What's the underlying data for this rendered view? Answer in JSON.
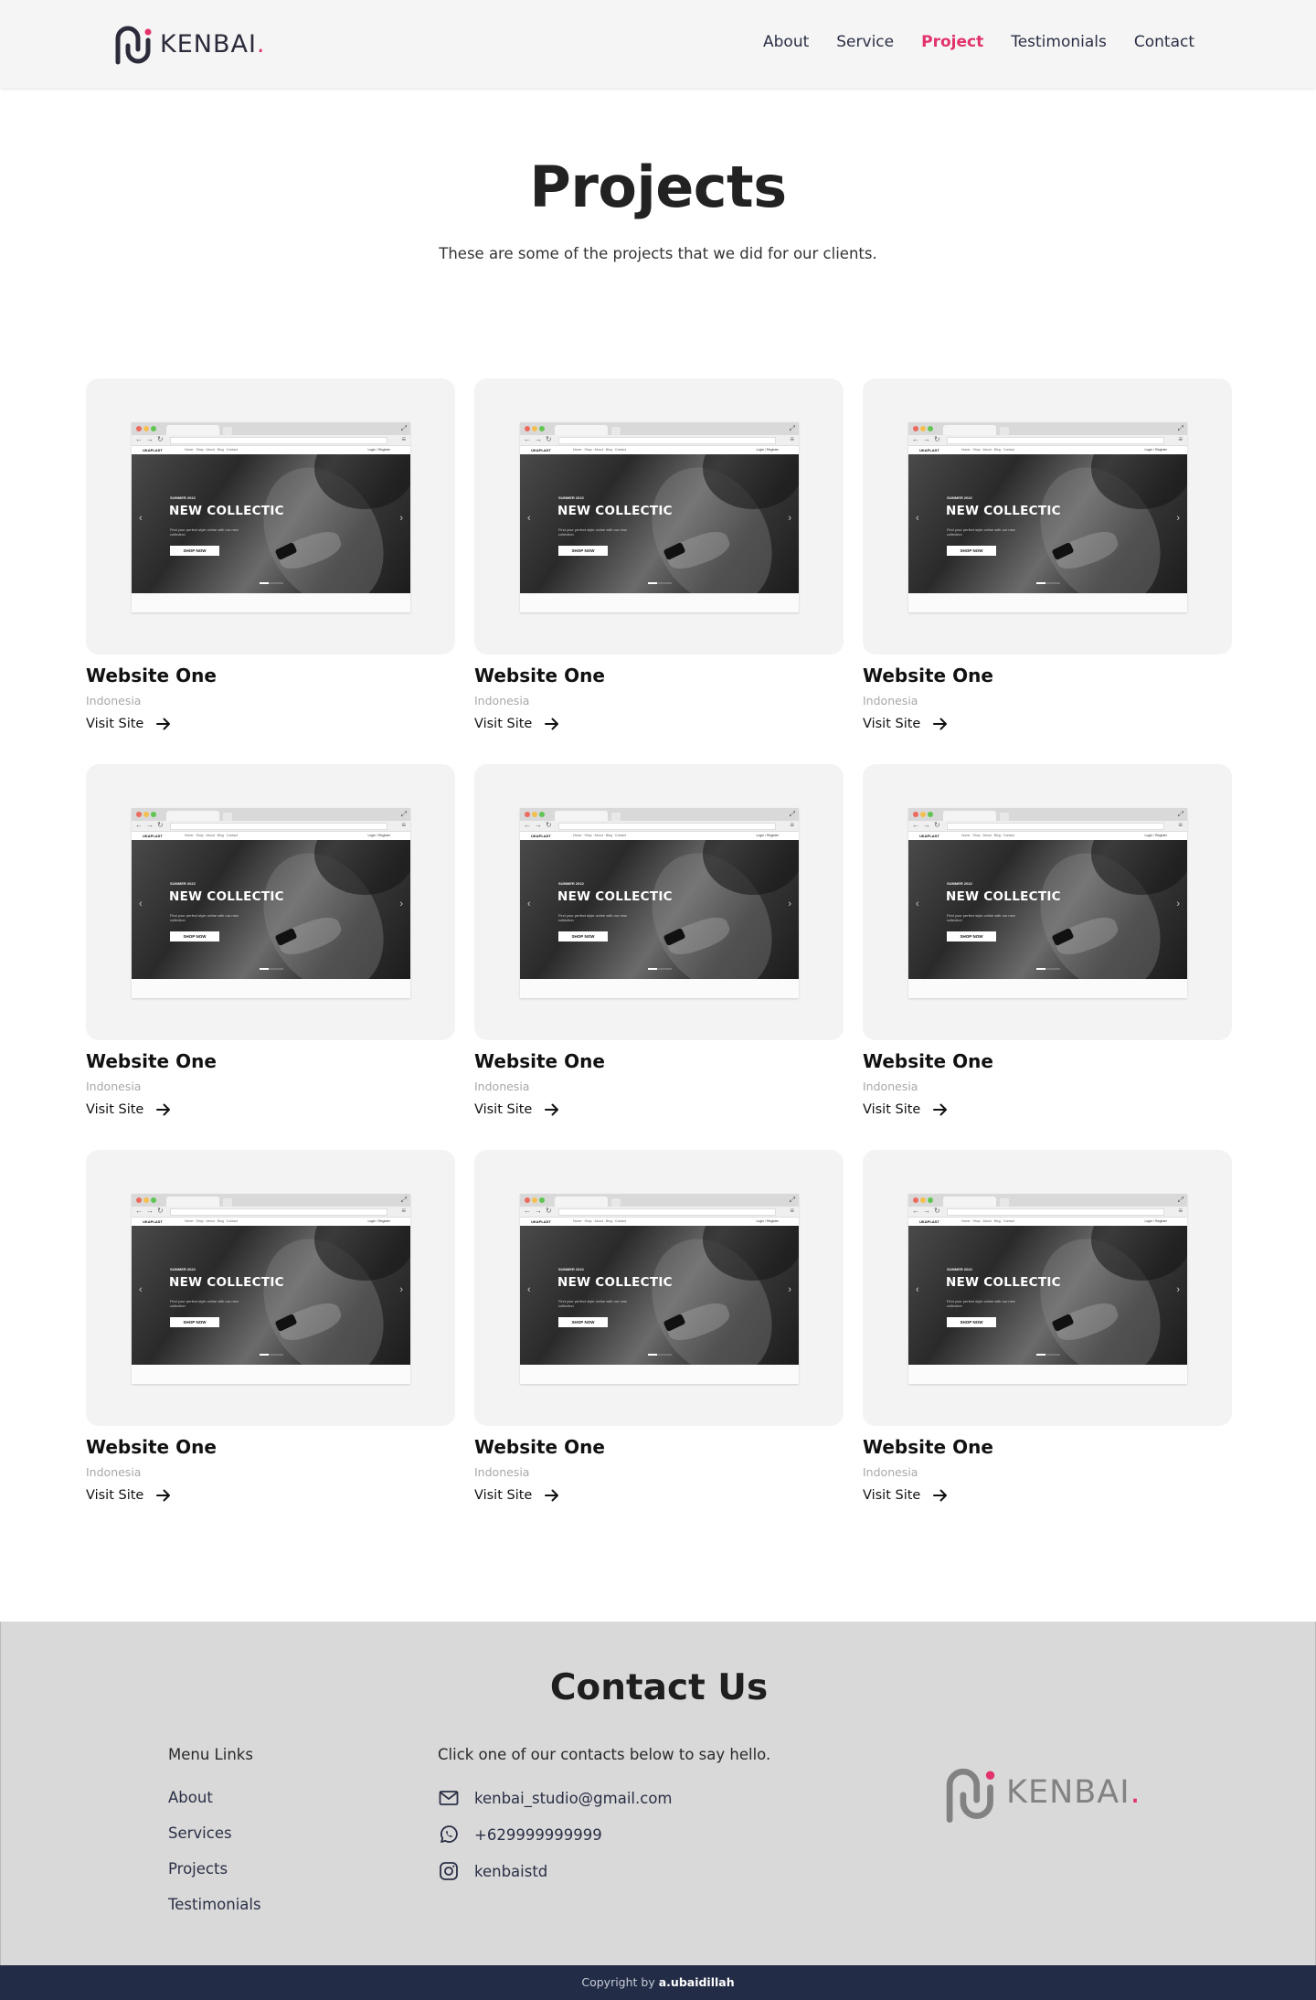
{
  "brand": {
    "name": "KENBAI",
    "dot": ".",
    "accent": "#e2336b"
  },
  "nav": {
    "links": [
      {
        "label": "About",
        "active": false
      },
      {
        "label": "Service",
        "active": false
      },
      {
        "label": "Project",
        "active": true
      },
      {
        "label": "Testimonials",
        "active": false
      },
      {
        "label": "Contact",
        "active": false
      }
    ]
  },
  "hero": {
    "title": "Projects",
    "subtitle": "These are some of the projects that we did for our clients."
  },
  "mockup": {
    "headline": "NEW COLLECTIC",
    "season": "SUMMER 2022",
    "copy": "Find your perfect style online with our new collection",
    "button": "SHOP NOW",
    "brand": "UKAPLAST",
    "links": "Home · Shop · About · Blog · Contact",
    "login": "Login / Register"
  },
  "projects": [
    {
      "title": "Website One",
      "location": "Indonesia",
      "link": "Visit Site"
    },
    {
      "title": "Website One",
      "location": "Indonesia",
      "link": "Visit Site"
    },
    {
      "title": "Website One",
      "location": "Indonesia",
      "link": "Visit Site"
    },
    {
      "title": "Website One",
      "location": "Indonesia",
      "link": "Visit Site"
    },
    {
      "title": "Website One",
      "location": "Indonesia",
      "link": "Visit Site"
    },
    {
      "title": "Website One",
      "location": "Indonesia",
      "link": "Visit Site"
    },
    {
      "title": "Website One",
      "location": "Indonesia",
      "link": "Visit Site"
    },
    {
      "title": "Website One",
      "location": "Indonesia",
      "link": "Visit Site"
    },
    {
      "title": "Website One",
      "location": "Indonesia",
      "link": "Visit Site"
    }
  ],
  "contact": {
    "title": "Contact Us",
    "menu_heading": "Menu Links",
    "menu": [
      "About",
      "Services",
      "Projects",
      "Testimonials"
    ],
    "intro": "Click one of our contacts below to say hello.",
    "email": "kenbai_studio@gmail.com",
    "phone": "+629999999999",
    "instagram": "kenbaistd",
    "icons": {
      "email": "mail-icon",
      "phone": "whatsapp-icon",
      "instagram": "instagram-icon"
    }
  },
  "footer": {
    "prefix": "Copyright by",
    "author": "a.ubaidillah"
  }
}
